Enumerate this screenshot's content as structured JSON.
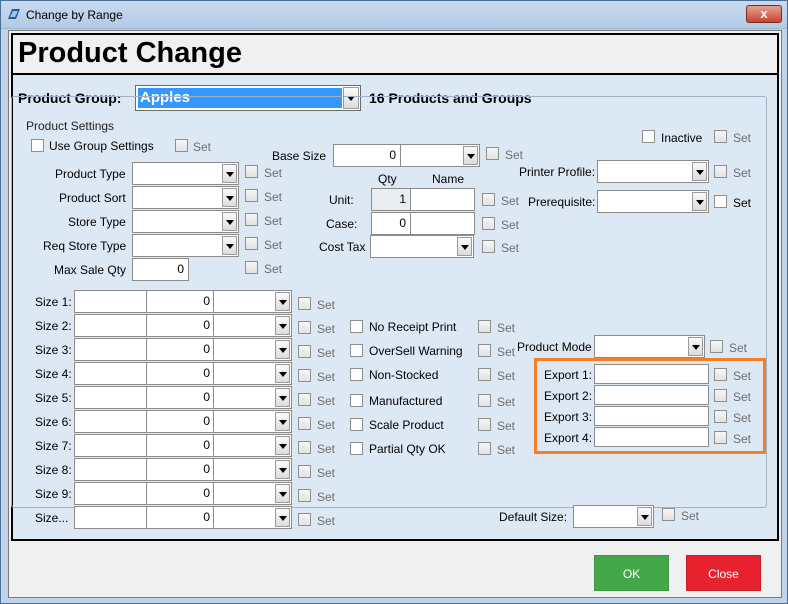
{
  "window": {
    "title": "Change by Range",
    "close_label": "x"
  },
  "header": {
    "title": "Product Change"
  },
  "product_group": {
    "label": "Product Group:",
    "value": "Apples",
    "count_text": "16 Products and Groups"
  },
  "settings": {
    "legend": "Product Settings",
    "set_label": "Set",
    "use_group_settings": "Use Group Settings",
    "inactive": "Inactive",
    "left_fields": [
      {
        "label": "Product Type"
      },
      {
        "label": "Product Sort"
      },
      {
        "label": "Store Type"
      },
      {
        "label": "Req Store Type"
      }
    ],
    "max_sale_qty": {
      "label": "Max Sale Qty",
      "value": "0"
    },
    "base_size": {
      "label": "Base Size",
      "value": "0"
    },
    "qty_header": "Qty",
    "name_header": "Name",
    "unit": {
      "label": "Unit:",
      "value": "1"
    },
    "case": {
      "label": "Case:",
      "value": "0"
    },
    "cost_tax": {
      "label": "Cost Tax"
    },
    "printer_profile": {
      "label": "Printer Profile:"
    },
    "prerequisite": {
      "label": "Prerequisite:"
    },
    "sizes": [
      {
        "label": "Size 1:",
        "value": "0"
      },
      {
        "label": "Size 2:",
        "value": "0"
      },
      {
        "label": "Size 3:",
        "value": "0"
      },
      {
        "label": "Size 4:",
        "value": "0"
      },
      {
        "label": "Size 5:",
        "value": "0"
      },
      {
        "label": "Size 6:",
        "value": "0"
      },
      {
        "label": "Size 7:",
        "value": "0"
      },
      {
        "label": "Size 8:",
        "value": "0"
      },
      {
        "label": "Size 9:",
        "value": "0"
      },
      {
        "label": "Size...",
        "value": "0"
      }
    ],
    "flags": [
      "No Receipt Print",
      "OverSell Warning",
      "Non-Stocked",
      "Manufactured",
      "Scale Product",
      "Partial Qty OK"
    ],
    "product_mode": {
      "label": "Product Mode"
    },
    "exports": [
      "Export 1:",
      "Export 2:",
      "Export 3:",
      "Export 4:"
    ],
    "default_size": {
      "label": "Default Size:"
    }
  },
  "buttons": {
    "ok": "OK",
    "close": "Close"
  },
  "colors": {
    "ok": "#44a84b",
    "close": "#e8212f",
    "highlight": "#f47f27",
    "selection": "#3399ff"
  }
}
